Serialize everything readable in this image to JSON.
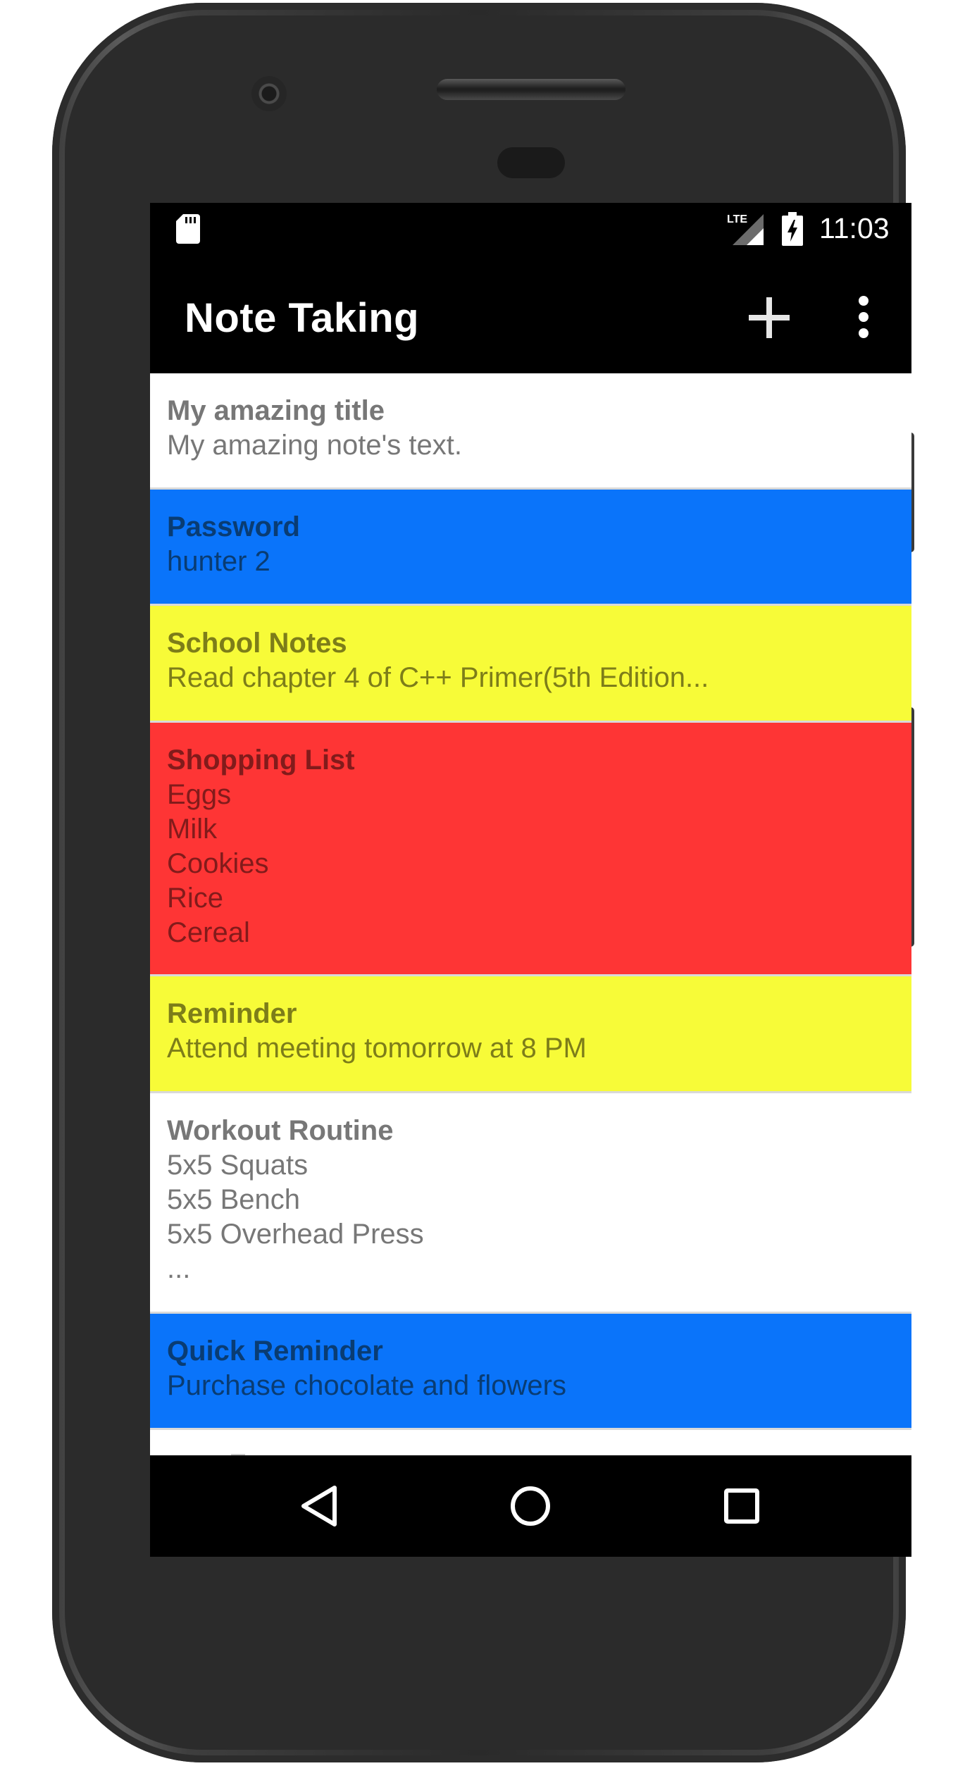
{
  "status_bar": {
    "time": "11:03",
    "network_icon": "lte-signal-icon",
    "battery_icon": "battery-charging-icon",
    "notification_icon": "sd-card-icon"
  },
  "app_bar": {
    "title": "Note Taking",
    "add_icon": "add-icon",
    "overflow_icon": "overflow-menu-icon"
  },
  "notes": [
    {
      "title": "My amazing title",
      "text": "My amazing note's text.",
      "bg": "#ffffff",
      "fg": "#777777"
    },
    {
      "title": "Password",
      "text": "hunter 2",
      "bg": "#0a74fa",
      "fg": "#093c73"
    },
    {
      "title": "School Notes",
      "text": "Read chapter 4 of C++ Primer(5th Edition...",
      "bg": "#f7fb38",
      "fg": "#7d7d19"
    },
    {
      "title": "Shopping List",
      "text": "Eggs\nMilk\nCookies\nRice\nCereal",
      "bg": "#fe3535",
      "fg": "#821b1b"
    },
    {
      "title": "Reminder",
      "text": "Attend meeting tomorrow at 8 PM",
      "bg": "#f7fb38",
      "fg": "#7d7d19"
    },
    {
      "title": "Workout Routine",
      "text": "5x5 Squats\n5x5 Bench\n5x5 Overhead Press\n...",
      "bg": "#ffffff",
      "fg": "#777777"
    },
    {
      "title": "Quick Reminder",
      "text": "Purchase chocolate and flowers",
      "bg": "#0a74fa",
      "fg": "#093c73"
    }
  ],
  "nav_bar": {
    "back_icon": "back-icon",
    "home_icon": "home-icon",
    "recents_icon": "recents-icon"
  },
  "colors": {
    "bar_background": "#000000",
    "icon_foreground": "#ffffff"
  }
}
